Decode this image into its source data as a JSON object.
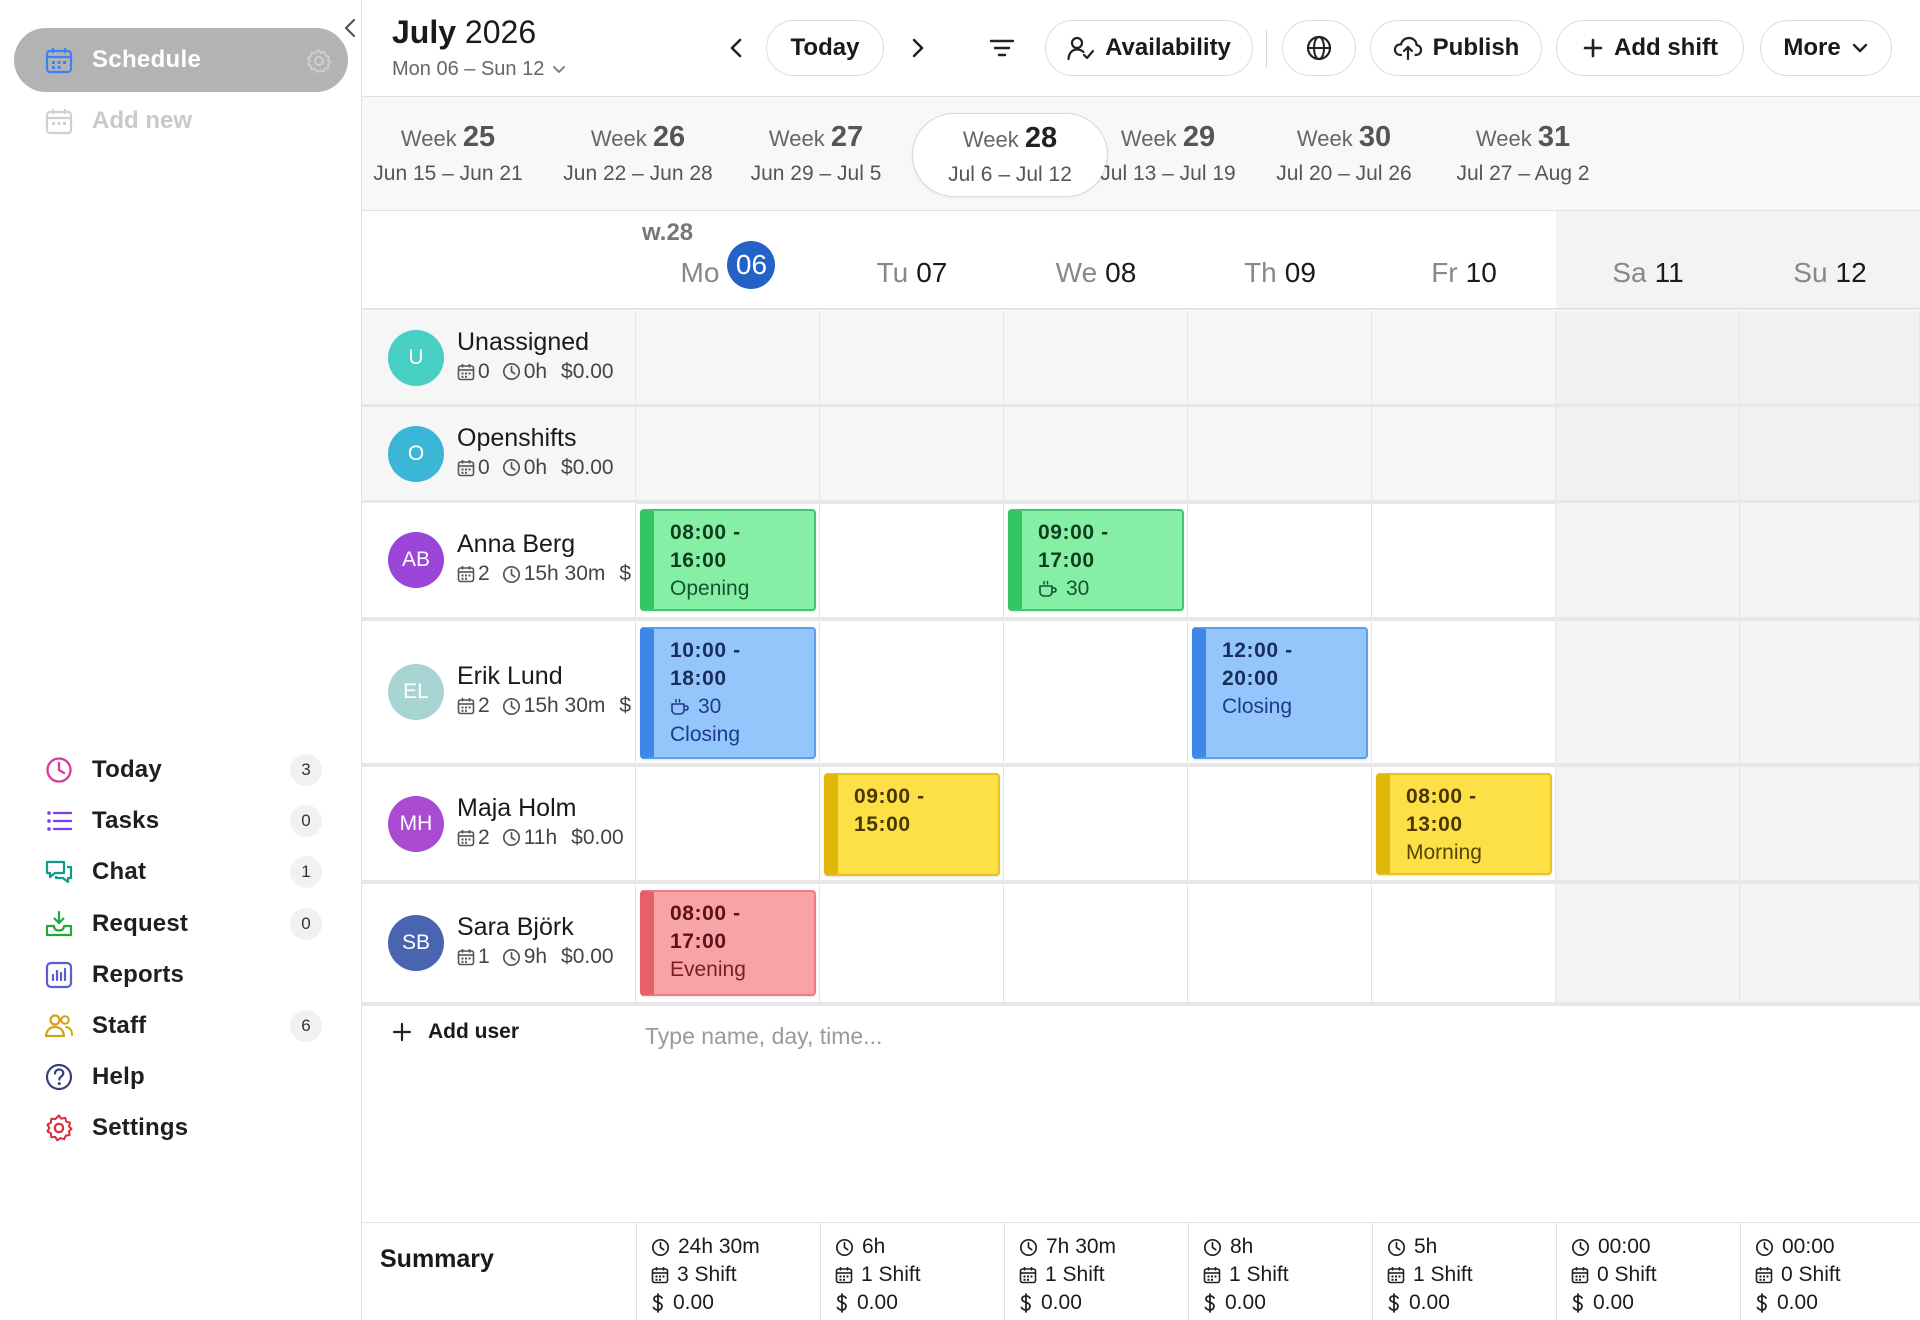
{
  "sidebar": {
    "schedule_label": "Schedule",
    "add_new_label": "Add new",
    "nav": [
      {
        "label": "Today",
        "badge": "3",
        "icon": "clock-icon",
        "color": "#d63b9b"
      },
      {
        "label": "Tasks",
        "badge": "0",
        "icon": "list-icon",
        "color": "#7c3aed"
      },
      {
        "label": "Chat",
        "badge": "1",
        "icon": "chat-icon",
        "color": "#0f9a8a"
      },
      {
        "label": "Request",
        "badge": "0",
        "icon": "inbox-icon",
        "color": "#22a83a"
      },
      {
        "label": "Reports",
        "badge": "",
        "icon": "bar-chart-icon",
        "color": "#5b5bd6"
      },
      {
        "label": "Staff",
        "badge": "6",
        "icon": "users-icon",
        "color": "#d4a017"
      },
      {
        "label": "Help",
        "badge": "",
        "icon": "help-icon",
        "color": "#3a3f7a"
      },
      {
        "label": "Settings",
        "badge": "",
        "icon": "gear-icon",
        "color": "#d92d3a"
      }
    ]
  },
  "header": {
    "month": "July",
    "year": "2026",
    "range": "Mon 06 – Sun 12",
    "today_label": "Today",
    "availability_label": "Availability",
    "publish_label": "Publish",
    "add_shift_label": "Add shift",
    "more_label": "More"
  },
  "weeks": [
    {
      "label": "Week",
      "num": "25",
      "dates": "Jun 15 – Jun 21",
      "active": false
    },
    {
      "label": "Week",
      "num": "26",
      "dates": "Jun 22 – Jun 28",
      "active": false
    },
    {
      "label": "Week",
      "num": "27",
      "dates": "Jun 29 – Jul 5",
      "active": false
    },
    {
      "label": "Week",
      "num": "28",
      "dates": "Jul 6 – Jul 12",
      "active": true
    },
    {
      "label": "Week",
      "num": "29",
      "dates": "Jul 13 – Jul 19",
      "active": false
    },
    {
      "label": "Week",
      "num": "30",
      "dates": "Jul 20 – Jul 26",
      "active": false
    },
    {
      "label": "Week",
      "num": "31",
      "dates": "Jul 27 – Aug 2",
      "active": false
    }
  ],
  "grid": {
    "week_label": "w.28",
    "days": [
      {
        "name": "Mo",
        "num": "06",
        "today": true,
        "weekend": false
      },
      {
        "name": "Tu",
        "num": "07",
        "today": false,
        "weekend": false
      },
      {
        "name": "We",
        "num": "08",
        "today": false,
        "weekend": false
      },
      {
        "name": "Th",
        "num": "09",
        "today": false,
        "weekend": false
      },
      {
        "name": "Fr",
        "num": "10",
        "today": false,
        "weekend": false
      },
      {
        "name": "Sa",
        "num": "11",
        "today": false,
        "weekend": true
      },
      {
        "name": "Su",
        "num": "12",
        "today": false,
        "weekend": true
      }
    ],
    "rows": [
      {
        "initials": "U",
        "name": "Unassigned",
        "avatar_color": "#46cfc2",
        "shifts_count": "0",
        "hours": "0h",
        "cost": "$0.00",
        "grey": true,
        "shifts": []
      },
      {
        "initials": "O",
        "name": "Openshifts",
        "avatar_color": "#3bb6d6",
        "shifts_count": "0",
        "hours": "0h",
        "cost": "$0.00",
        "grey": true,
        "shifts": []
      },
      {
        "initials": "AB",
        "name": "Anna Berg",
        "avatar_color": "#9b46d9",
        "shifts_count": "2",
        "hours": "15h 30m",
        "cost": "$",
        "grey": false,
        "shifts": [
          {
            "day": 0,
            "color": "green",
            "start": "08:00 -",
            "end": "16:00",
            "break": "",
            "label": "Opening"
          },
          {
            "day": 2,
            "color": "green",
            "start": "09:00 -",
            "end": "17:00",
            "break": "30",
            "label": ""
          }
        ]
      },
      {
        "initials": "EL",
        "name": "Erik Lund",
        "avatar_color": "#a8d4d4",
        "shifts_count": "2",
        "hours": "15h 30m",
        "cost": "$",
        "grey": false,
        "shifts": [
          {
            "day": 0,
            "color": "blue",
            "start": "10:00 -",
            "end": "18:00",
            "break": "30",
            "label": "Closing"
          },
          {
            "day": 3,
            "color": "blue",
            "start": "12:00 -",
            "end": "20:00",
            "break": "",
            "label": "Closing"
          }
        ]
      },
      {
        "initials": "MH",
        "name": "Maja Holm",
        "avatar_color": "#a84bd0",
        "shifts_count": "2",
        "hours": "11h",
        "cost": "$0.00",
        "grey": false,
        "shifts": [
          {
            "day": 1,
            "color": "yellow",
            "start": "09:00 -",
            "end": "15:00",
            "break": "",
            "label": ""
          },
          {
            "day": 4,
            "color": "yellow",
            "start": "08:00 -",
            "end": "13:00",
            "break": "",
            "label": "Morning"
          }
        ]
      },
      {
        "initials": "SB",
        "name": "Sara Björk",
        "avatar_color": "#4a64b0",
        "shifts_count": "1",
        "hours": "9h",
        "cost": "$0.00",
        "grey": false,
        "shifts": [
          {
            "day": 0,
            "color": "red",
            "start": "08:00 -",
            "end": "17:00",
            "break": "",
            "label": "Evening"
          }
        ]
      }
    ],
    "add_user_label": "Add user",
    "quick_placeholder": "Type name, day, time..."
  },
  "summary": {
    "title": "Summary",
    "days": [
      {
        "hours": "24h 30m",
        "shifts": "3 Shift",
        "cost": "0.00"
      },
      {
        "hours": "6h",
        "shifts": "1 Shift",
        "cost": "0.00"
      },
      {
        "hours": "7h 30m",
        "shifts": "1 Shift",
        "cost": "0.00"
      },
      {
        "hours": "8h",
        "shifts": "1 Shift",
        "cost": "0.00"
      },
      {
        "hours": "5h",
        "shifts": "1 Shift",
        "cost": "0.00"
      },
      {
        "hours": "00:00",
        "shifts": "0 Shift",
        "cost": "0.00"
      },
      {
        "hours": "00:00",
        "shifts": "0 Shift",
        "cost": "0.00"
      }
    ]
  },
  "colors": {
    "accent": "#2562c8"
  }
}
